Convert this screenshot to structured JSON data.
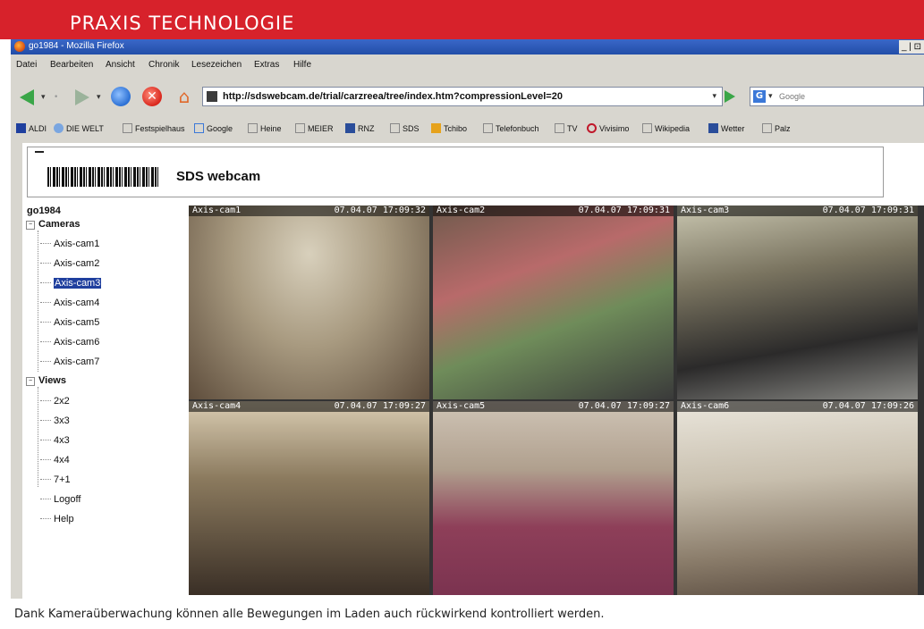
{
  "magazine": {
    "section_title": "PRAXIS TECHNOLOGIE",
    "caption": "Dank Kameraüberwachung können alle Bewegungen im Laden auch rückwirkend kontrolliert werden.",
    "accent_color": "#d7222b"
  },
  "window": {
    "title": "go1984 - Mozilla Firefox",
    "controls": "_ | ⊡"
  },
  "menubar": {
    "items": [
      "Datei",
      "Bearbeiten",
      "Ansicht",
      "Chronik",
      "Lesezeichen",
      "Extras",
      "Hilfe"
    ]
  },
  "navbar": {
    "url": "http://sdswebcam.de/trial/carzreea/tree/index.htm?compressionLevel=20",
    "search_placeholder": "Google"
  },
  "bookmarks": [
    {
      "label": "ALDI",
      "icon": "aldi-icon"
    },
    {
      "label": "DIE WELT",
      "icon": "welt-icon"
    },
    {
      "label": "Festspielhaus",
      "icon": "folder-icon"
    },
    {
      "label": "Google",
      "icon": "google-icon"
    },
    {
      "label": "Heine",
      "icon": "folder-icon"
    },
    {
      "label": "MEIER",
      "icon": "folder-icon"
    },
    {
      "label": "RNZ",
      "icon": "rnz-icon"
    },
    {
      "label": "SDS",
      "icon": "folder-icon"
    },
    {
      "label": "Tchibo",
      "icon": "tchibo-icon"
    },
    {
      "label": "Telefonbuch",
      "icon": "folder-icon"
    },
    {
      "label": "TV",
      "icon": "folder-icon"
    },
    {
      "label": "Vivisimo",
      "icon": "vivisimo-icon"
    },
    {
      "label": "Wikipedia",
      "icon": "folder-icon"
    },
    {
      "label": "Wetter",
      "icon": "wetter-icon"
    },
    {
      "label": "Palz",
      "icon": "folder-icon"
    }
  ],
  "app": {
    "brand": "SDS webcam",
    "tree": {
      "root": "go1984",
      "cameras_label": "Cameras",
      "cameras": [
        "Axis-cam1",
        "Axis-cam2",
        "Axis-cam3",
        "Axis-cam4",
        "Axis-cam5",
        "Axis-cam6",
        "Axis-cam7"
      ],
      "selected_camera": "Axis-cam3",
      "views_label": "Views",
      "views": [
        "2x2",
        "3x3",
        "4x3",
        "4x4",
        "7+1"
      ],
      "logoff_label": "Logoff",
      "help_label": "Help"
    },
    "feeds": [
      {
        "name": "Axis-cam1",
        "timestamp": "07.04.07 17:09:32"
      },
      {
        "name": "Axis-cam2",
        "timestamp": "07.04.07 17:09:31"
      },
      {
        "name": "Axis-cam3",
        "timestamp": "07.04.07 17:09:31"
      },
      {
        "name": "Axis-cam4",
        "timestamp": "07.04.07 17:09:27"
      },
      {
        "name": "Axis-cam5",
        "timestamp": "07.04.07 17:09:27"
      },
      {
        "name": "Axis-cam6",
        "timestamp": "07.04.07 17:09:26"
      }
    ]
  }
}
